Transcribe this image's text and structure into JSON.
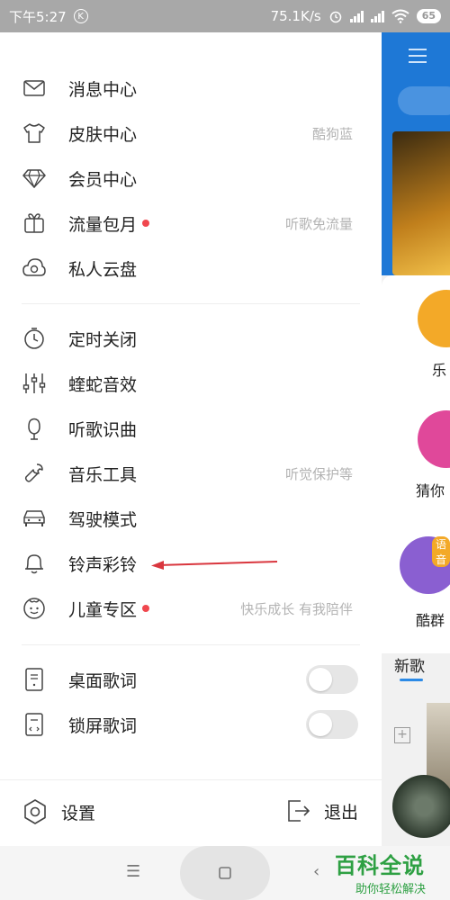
{
  "status_bar": {
    "time": "下午5:27",
    "k_icon": "K",
    "net_speed": "75.1K/s",
    "battery": "65"
  },
  "drawer": {
    "group1": [
      {
        "label": "消息中心",
        "hint": "",
        "icon": "mail-icon",
        "dot": false
      },
      {
        "label": "皮肤中心",
        "hint": "酷狗蓝",
        "icon": "tshirt-icon",
        "dot": false
      },
      {
        "label": "会员中心",
        "hint": "",
        "icon": "diamond-icon",
        "dot": false
      },
      {
        "label": "流量包月",
        "hint": "听歌免流量",
        "icon": "gift-icon",
        "dot": true
      },
      {
        "label": "私人云盘",
        "hint": "",
        "icon": "cloud-disc-icon",
        "dot": false
      }
    ],
    "group2": [
      {
        "label": "定时关闭",
        "hint": "",
        "icon": "timer-icon",
        "dot": false
      },
      {
        "label": "蝰蛇音效",
        "hint": "",
        "icon": "equalizer-icon",
        "dot": false
      },
      {
        "label": "听歌识曲",
        "hint": "",
        "icon": "mic-icon",
        "dot": false
      },
      {
        "label": "音乐工具",
        "hint": "听觉保护等",
        "icon": "wrench-icon",
        "dot": false
      },
      {
        "label": "驾驶模式",
        "hint": "",
        "icon": "car-icon",
        "dot": false
      },
      {
        "label": "铃声彩铃",
        "hint": "",
        "icon": "bell-icon",
        "dot": false
      },
      {
        "label": "儿童专区",
        "hint": "快乐成长 有我陪伴",
        "icon": "kid-face-icon",
        "dot": true
      }
    ],
    "group3": [
      {
        "label": "桌面歌词",
        "icon": "desktop-lyrics-icon",
        "toggle_on": false
      },
      {
        "label": "锁屏歌词",
        "icon": "lockscreen-lyrics-icon",
        "toggle_on": false
      }
    ],
    "bottom": {
      "settings_label": "设置",
      "exit_label": "退出"
    }
  },
  "background_app": {
    "labels": [
      "乐",
      "猜你",
      "酷群",
      "语音",
      "新歌"
    ]
  },
  "watermark": {
    "title": "百科全说",
    "subtitle": "助你轻松解决"
  },
  "colors": {
    "accent_blue": "#1e78d6",
    "red_dot": "#f0474e",
    "annotation_arrow": "#d9363e",
    "watermark_green": "#2ea043"
  }
}
